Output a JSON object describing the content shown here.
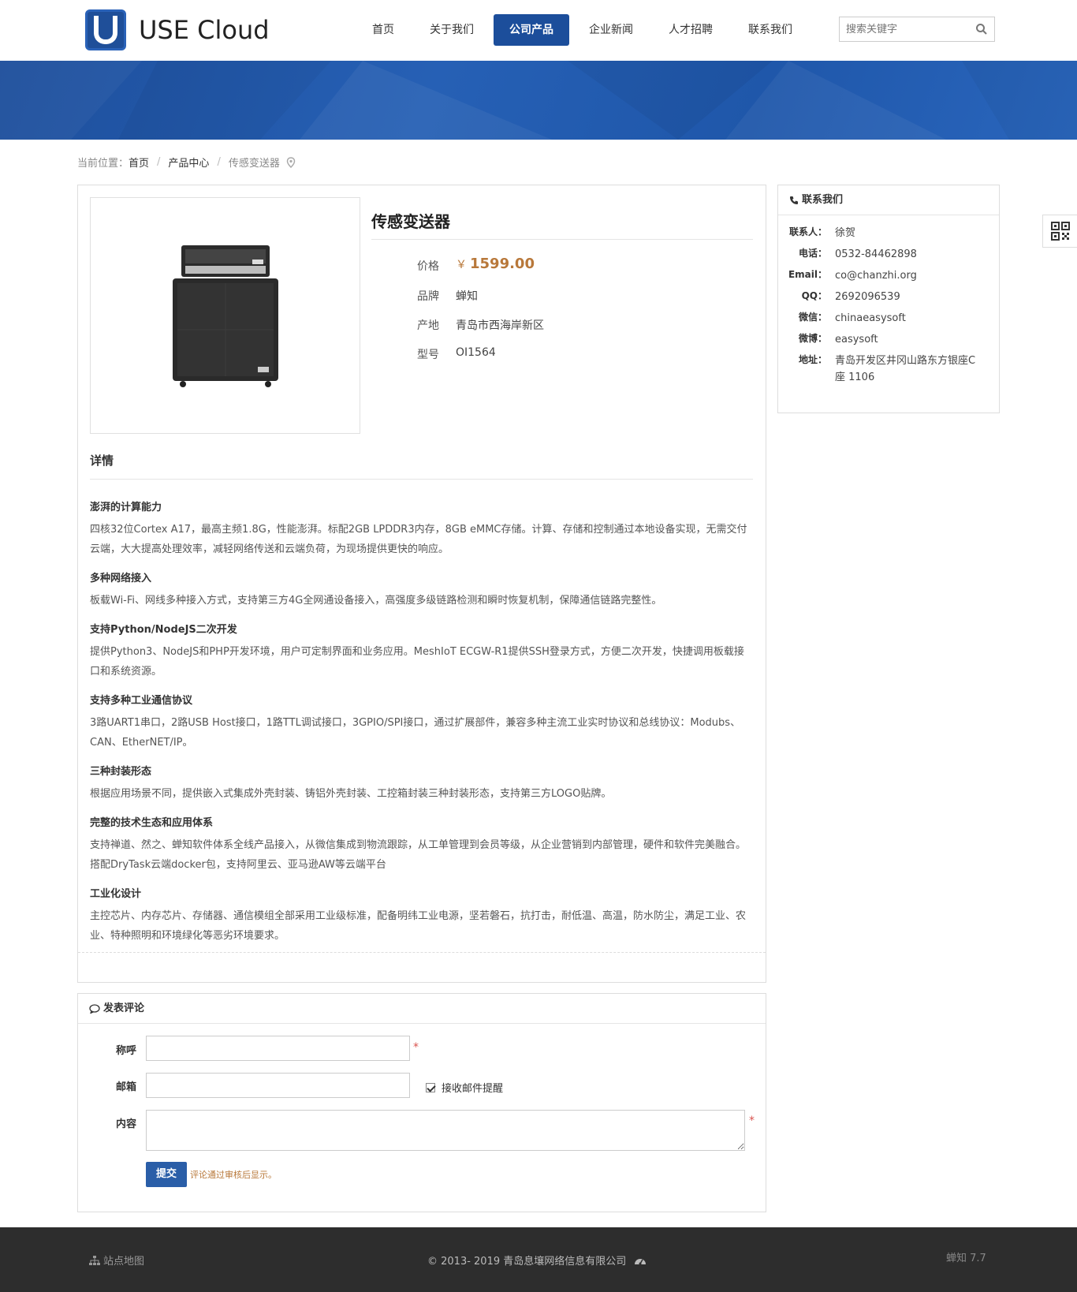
{
  "header": {
    "brand": "USE Cloud",
    "nav": [
      "首页",
      "关于我们",
      "公司产品",
      "企业新闻",
      "人才招聘",
      "联系我们"
    ],
    "active_nav": "公司产品",
    "search_placeholder": "搜索关键字"
  },
  "breadcrumb": {
    "prefix": "当前位置：",
    "home": "首页",
    "category": "产品中心",
    "current": "传感变送器"
  },
  "product": {
    "title": "传感变送器",
    "price_label": "价格",
    "currency": "￥",
    "price": "1599.00",
    "brand_label": "品牌",
    "brand": "蝉知",
    "origin_label": "产地",
    "origin": "青岛市西海岸新区",
    "model_label": "型号",
    "model": "OI1564"
  },
  "detail": {
    "title": "详情",
    "sections": [
      {
        "h": "澎湃的计算能力",
        "p": "四核32位Cortex A17，最高主频1.8G，性能澎湃。标配2GB LPDDR3内存，8GB eMMC存储。计算、存储和控制通过本地设备实现，无需交付云端，大大提高处理效率，减轻网络传送和云端负荷，为现场提供更快的响应。"
      },
      {
        "h": "多种网络接入",
        "p": "板载Wi-Fi、网线多种接入方式，支持第三方4G全网通设备接入，高强度多级链路检测和瞬时恢复机制，保障通信链路完整性。"
      },
      {
        "h": "支持Python/NodeJS二次开发",
        "p": "提供Python3、NodeJS和PHP开发环境，用户可定制界面和业务应用。MeshIoT ECGW-R1提供SSH登录方式，方便二次开发，快捷调用板载接口和系统资源。"
      },
      {
        "h": "支持多种工业通信协议",
        "p": "3路UART1串口，2路USB Host接口，1路TTL调试接口，3GPIO/SPI接口，通过扩展部件，兼容多种主流工业实时协议和总线协议：Modubs、CAN、EtherNET/IP。"
      },
      {
        "h": "三种封装形态",
        "p": "根据应用场景不同，提供嵌入式集成外壳封装、铸铝外壳封装、工控箱封装三种封装形态，支持第三方LOGO贴牌。"
      },
      {
        "h": "完整的技术生态和应用体系",
        "p": "支持禅道、然之、蝉知软件体系全线产品接入，从微信集成到物流跟踪，从工单管理到会员等级，从企业营销到内部管理，硬件和软件完美融合。搭配DryTask云端docker包，支持阿里云、亚马逊AW等云端平台"
      },
      {
        "h": "工业化设计",
        "p": "主控芯片、内存芯片、存储器、通信模组全部采用工业级标准，配备明纬工业电源，坚若磐石，抗打击，耐低温、高温，防水防尘，满足工业、农业、特种照明和环境绿化等恶劣环境要求。"
      }
    ]
  },
  "sidebar": {
    "title": "联系我们",
    "rows": [
      {
        "k": "联系人：",
        "v": "徐贺"
      },
      {
        "k": "电话：",
        "v": "0532-84462898"
      },
      {
        "k": "Email：",
        "v": "co@chanzhi.org"
      },
      {
        "k": "QQ：",
        "v": "2692096539"
      },
      {
        "k": "微信：",
        "v": "chinaeasysoft"
      },
      {
        "k": "微博：",
        "v": "easysoft"
      },
      {
        "k": "地址：",
        "v": "青岛开发区井冈山路东方银座C座 1106"
      }
    ]
  },
  "comment": {
    "title": "发表评论",
    "name_label": "称呼",
    "email_label": "邮箱",
    "content_label": "内容",
    "required_mark": "*",
    "notify_label": "接收邮件提醒",
    "submit": "提交",
    "hint": "评论通过审核后显示。"
  },
  "footer": {
    "sitemap": "站点地图",
    "copyright": "© 2013- 2019 青岛息壤网络信息有限公司",
    "powered": "蝉知 7.7"
  },
  "colors": {
    "primary": "#1c4e9b",
    "price": "#b8783a",
    "footer_bg": "#2d2d2d"
  }
}
